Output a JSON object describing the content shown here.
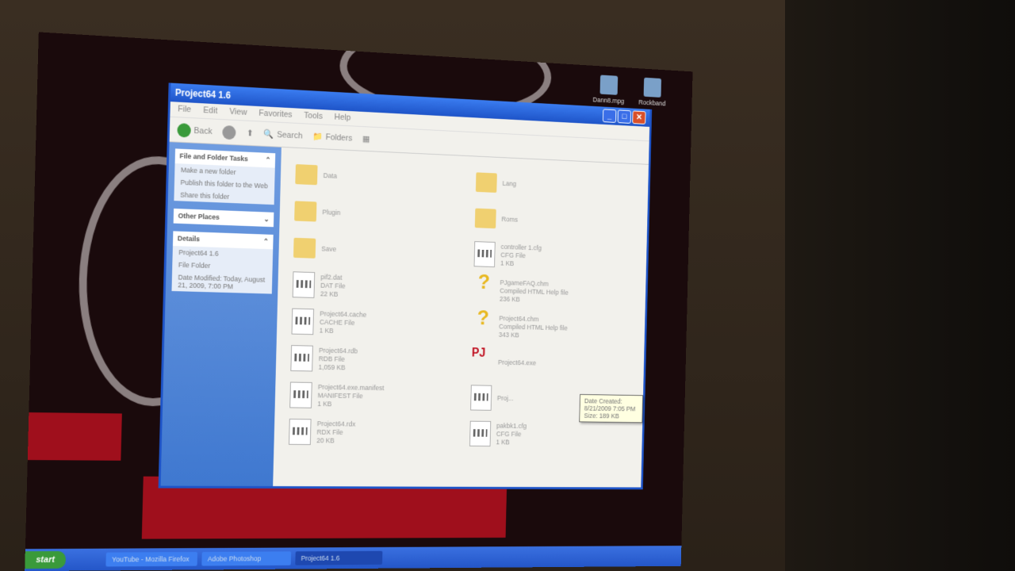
{
  "desktop": {
    "icons": [
      "Dann8.mpg",
      "Rockband"
    ]
  },
  "window": {
    "title": "Project64 1.6",
    "menu": [
      "File",
      "Edit",
      "View",
      "Favorites",
      "Tools",
      "Help"
    ],
    "toolbar": {
      "back": "Back",
      "search": "Search",
      "folders": "Folders"
    },
    "side": {
      "tasks_title": "File and Folder Tasks",
      "tasks": [
        "Make a new folder",
        "Publish this folder to the Web",
        "Share this folder"
      ],
      "other_title": "Other Places",
      "details_title": "Details",
      "details": [
        "Project64 1.6",
        "File Folder",
        "Date Modified: Today, August 21, 2009, 7:00 PM"
      ]
    },
    "items": [
      {
        "name": "Data",
        "type": "folder"
      },
      {
        "name": "Lang",
        "type": "folder"
      },
      {
        "name": "Plugin",
        "type": "folder"
      },
      {
        "name": "Roms",
        "type": "folder"
      },
      {
        "name": "Save",
        "type": "folder"
      },
      {
        "name": "controller 1.cfg",
        "kind": "CFG File",
        "size": "1 KB",
        "type": "file"
      },
      {
        "name": "pif2.dat",
        "kind": "DAT File",
        "size": "22 KB",
        "type": "file"
      },
      {
        "name": "PJgameFAQ.chm",
        "kind": "Compiled HTML Help file",
        "size": "236 KB",
        "type": "help"
      },
      {
        "name": "Project64.cache",
        "kind": "CACHE File",
        "size": "1 KB",
        "type": "file"
      },
      {
        "name": "Project64.chm",
        "kind": "Compiled HTML Help file",
        "size": "343 KB",
        "type": "help"
      },
      {
        "name": "Project64.rdb",
        "kind": "RDB File",
        "size": "1,059 KB",
        "type": "file"
      },
      {
        "name": "Project64.exe",
        "type": "exe"
      },
      {
        "name": "Project64.exe.manifest",
        "kind": "MANIFEST File",
        "size": "1 KB",
        "type": "manifest"
      },
      {
        "name": "Proj...",
        "kind": "",
        "size": "",
        "type": "file"
      },
      {
        "name": "Project64.rdx",
        "kind": "RDX File",
        "size": "20 KB",
        "type": "file"
      },
      {
        "name": "pakbk1.cfg",
        "kind": "CFG File",
        "size": "1 KB",
        "type": "file"
      }
    ],
    "tooltip": {
      "line1": "Date Created: 8/21/2009 7:05 PM",
      "line2": "Size: 189 KB"
    }
  },
  "taskbar": {
    "start": "start",
    "tasks": [
      "YouTube - Mozilla Firefox",
      "Adobe Photoshop",
      "Project64 1.6"
    ]
  }
}
